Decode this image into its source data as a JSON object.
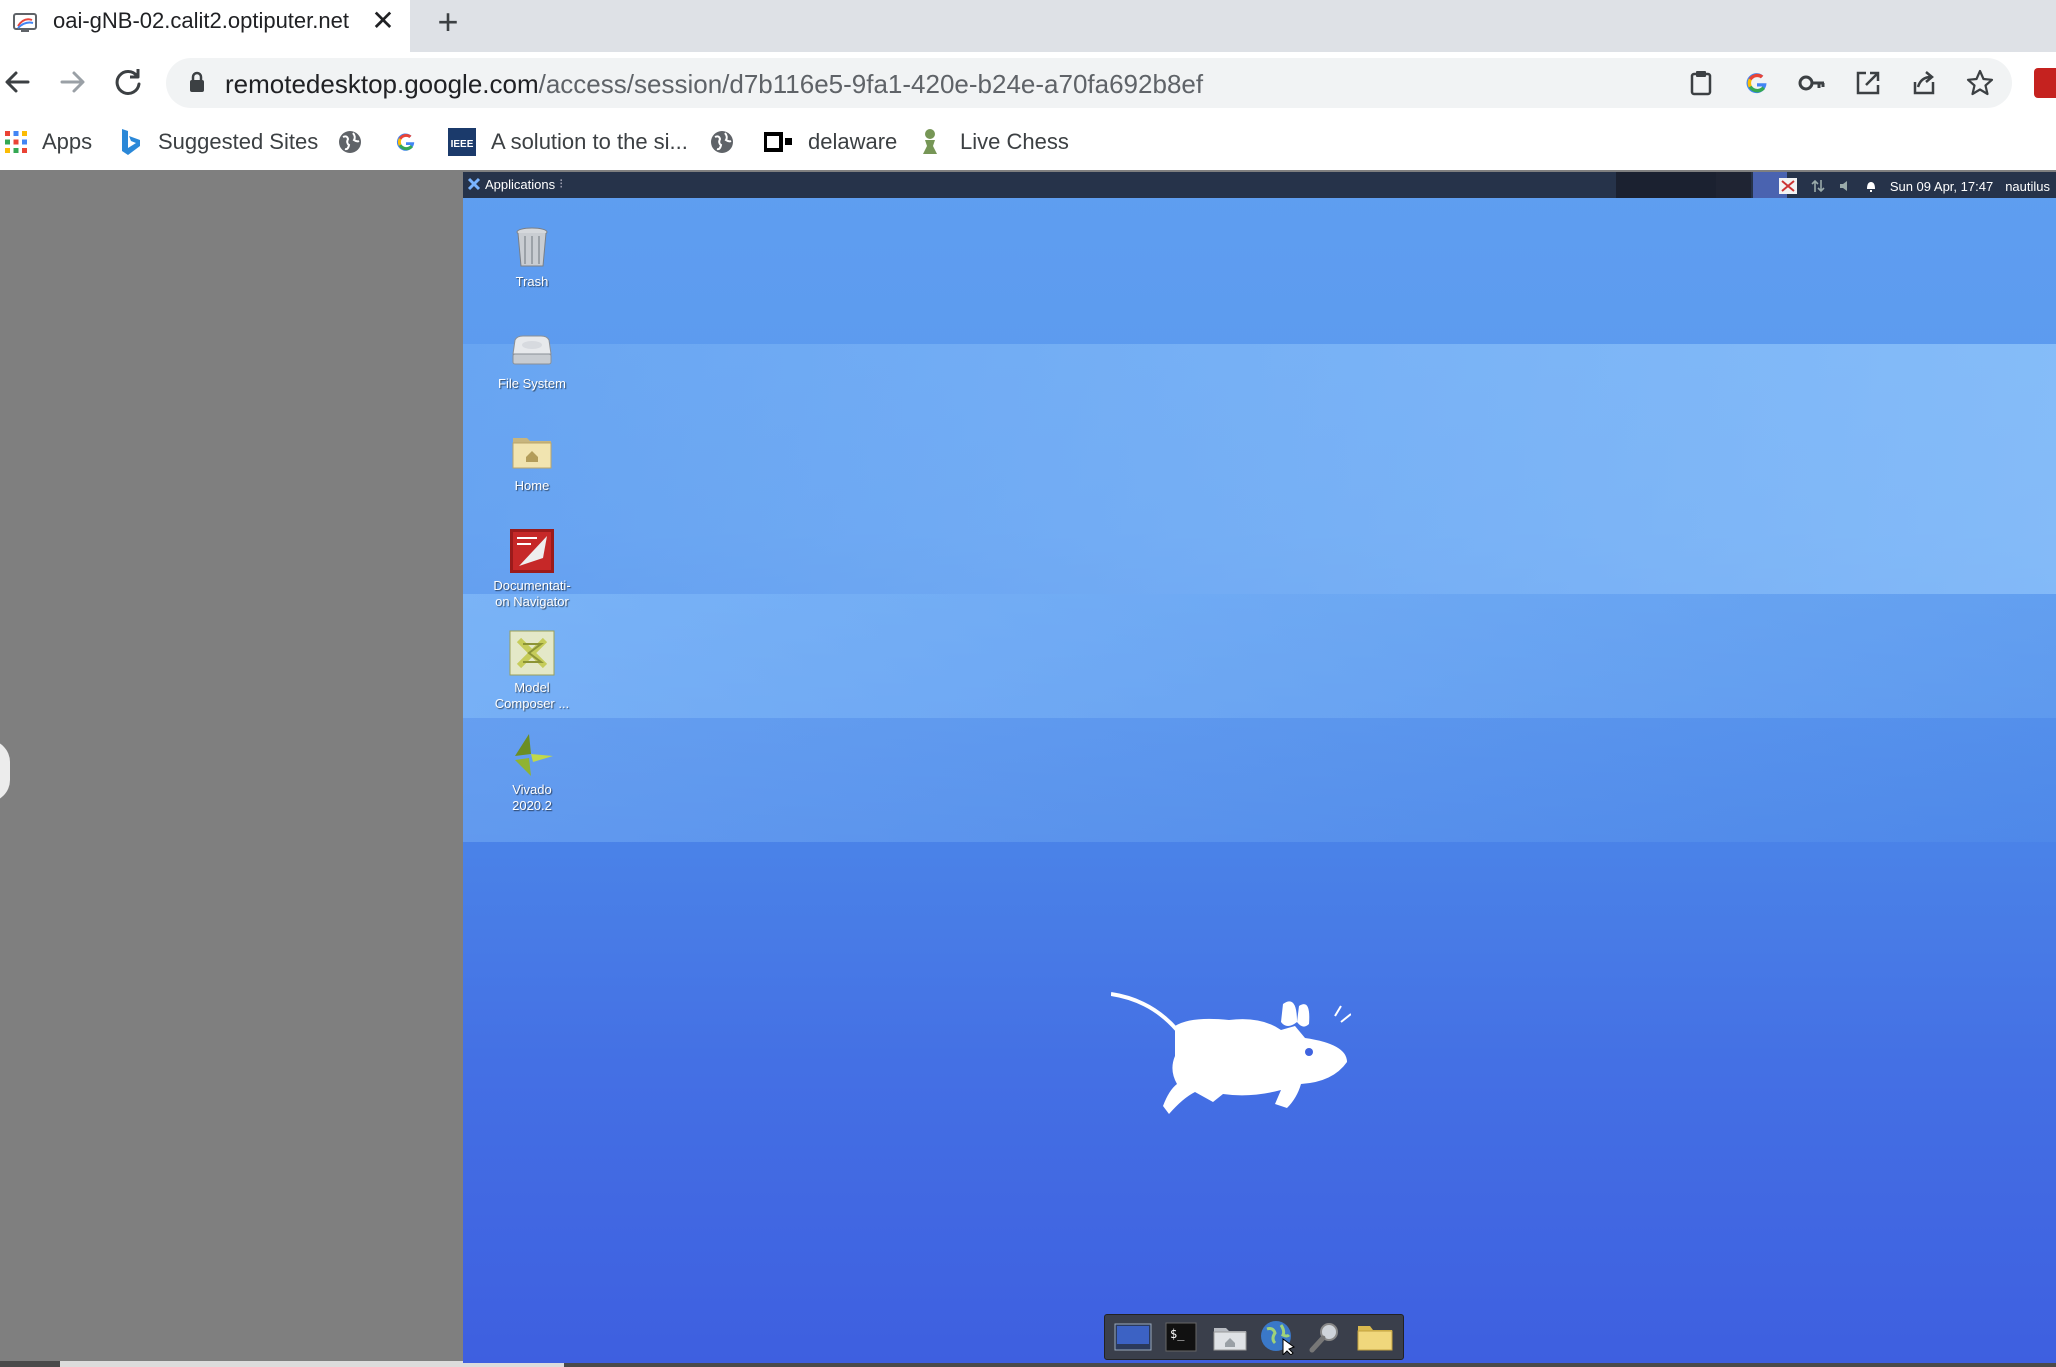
{
  "tab": {
    "title": "oai-gNB-02.calit2.optiputer.net",
    "close_glyph": "✕",
    "new_tab_glyph": "+"
  },
  "toolbar": {
    "back_icon": "arrow-left-icon",
    "forward_icon": "arrow-right-icon",
    "reload_icon": "reload-icon",
    "url_host": "remotedesktop.google.com",
    "url_path": "/access/session/d7b116e5-9fa1-420e-b24e-a70fa692b8ef"
  },
  "bookmarks": {
    "items": [
      {
        "label": "Apps",
        "icon": "apps-grid-icon"
      },
      {
        "label": "Suggested Sites",
        "icon": "bing-icon"
      },
      {
        "label": "",
        "icon": "globe-icon"
      },
      {
        "label": "",
        "icon": "google-icon"
      },
      {
        "label": "A solution to the si...",
        "icon": "ieee-icon"
      },
      {
        "label": "",
        "icon": "globe-icon"
      },
      {
        "label": "delaware",
        "icon": "delaware-icon"
      },
      {
        "label": "Live Chess",
        "icon": "chess-pawn-icon"
      }
    ]
  },
  "desktop": {
    "panel": {
      "applications_label": "Applications",
      "clock": "Sun 09 Apr, 17:47",
      "user": "nautilus"
    },
    "icons": [
      {
        "label": "Trash",
        "icon": "trash-icon"
      },
      {
        "label": "File System",
        "icon": "drive-icon"
      },
      {
        "label": "Home",
        "icon": "home-folder-icon"
      },
      {
        "label_line1": "Documentati-",
        "label_line2": "on Navigator",
        "icon": "documentation-navigator-icon"
      },
      {
        "label_line1": "Model",
        "label_line2": "Composer ...",
        "icon": "model-composer-icon"
      },
      {
        "label_line1": "Vivado",
        "label_line2": "2020.2",
        "icon": "vivado-icon"
      }
    ],
    "dock": [
      "show-desktop-icon",
      "terminal-icon",
      "home-folder-icon",
      "web-browser-icon",
      "search-icon",
      "folder-icon"
    ]
  },
  "colors": {
    "chrome_tabstrip": "#dee1e6",
    "omnibox": "#f1f3f4",
    "desktop_top": "#5f9ef0",
    "desktop_bottom": "#3e5fe0",
    "panel": "#26334a"
  }
}
